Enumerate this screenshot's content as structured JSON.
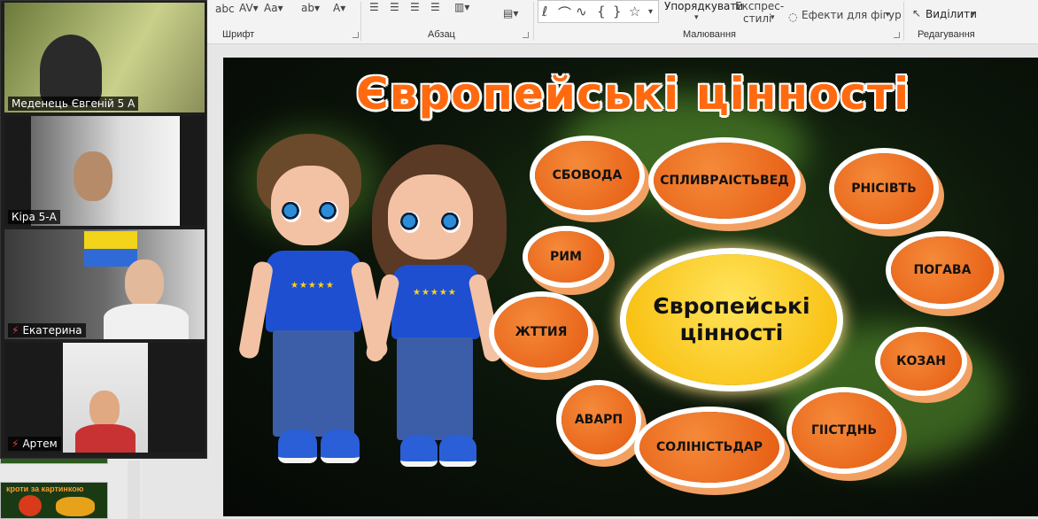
{
  "ribbon": {
    "font_group_label": "Шрифт",
    "paragraph_group_label": "Абзац",
    "drawing_group_label": "Малювання",
    "editing_group_label": "Редагування",
    "arrange_label": "Упорядкувати",
    "quick_styles_label_line1": "Експрес-",
    "quick_styles_label_line2": "стилі",
    "shape_effects_label": "Ефекти для фігур",
    "select_label": "Виділити"
  },
  "participants": [
    {
      "name": "Меденець Євгеній 5 А",
      "muted": false
    },
    {
      "name": "Кіра 5-А",
      "muted": false
    },
    {
      "name": "Екатерина",
      "muted": true
    },
    {
      "name": "Артем",
      "muted": true
    }
  ],
  "thumbnail": {
    "caption": "кроти за картинкою"
  },
  "slide": {
    "title": "Європейські цінності",
    "center_line1": "Європейські",
    "center_line2": "цінності",
    "clouds": [
      "СБОВОДА",
      "СПЛИВРАІСТЬВЕД",
      "РНІСІВТЬ",
      "РИМ",
      "ПОГАВА",
      "ЖТТИЯ",
      "КОЗАН",
      "АВАРП",
      "СОЛІНІСТЬДАР",
      "ГІІСТДНЬ"
    ]
  },
  "colors": {
    "accent": "#ff6a10",
    "cloud": "#e8641a",
    "center": "#f7c500",
    "background": "#0b130a"
  }
}
